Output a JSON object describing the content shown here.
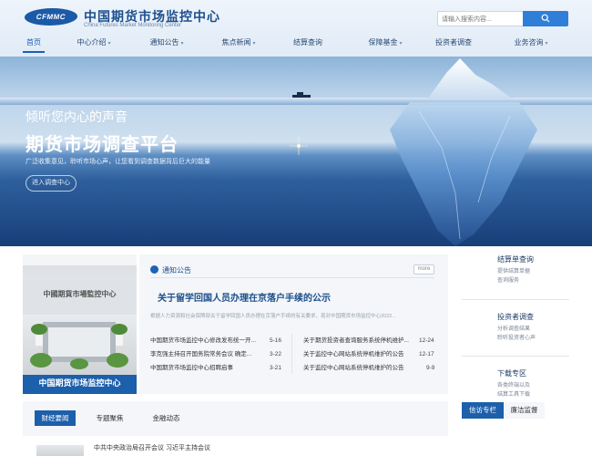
{
  "header": {
    "logo_abbr": "CFMMC",
    "logo_cn": "中国期货市场监控中心",
    "logo_en": "China Futures Market Monitoring Center",
    "search_placeholder": "请输入搜索内容..."
  },
  "nav": {
    "items": [
      {
        "label": "首页",
        "active": true,
        "dropdown": false
      },
      {
        "label": "中心介绍",
        "dropdown": true
      },
      {
        "label": "通知公告",
        "dropdown": true
      },
      {
        "label": "焦点新闻",
        "dropdown": true
      },
      {
        "label": "结算查询",
        "dropdown": false
      },
      {
        "label": "保障基金",
        "dropdown": true
      },
      {
        "label": "投资者调查",
        "dropdown": false
      },
      {
        "label": "业务咨询",
        "dropdown": true
      }
    ]
  },
  "banner": {
    "slogan1": "倾听您内心的声音",
    "slogan2": "期货市场调查平台",
    "slogan3": "广泛收集意见，聆听市场心声，让您看到调查数据背后巨大的能量",
    "button": "进入调查中心"
  },
  "photo": {
    "caption": "中国期货市场监控中心",
    "sign_text": "中國期貨市場監控中心"
  },
  "notice": {
    "title": "通知公告",
    "more": "more",
    "headline": "关于留学回国人员办理在京落户手续的公示",
    "headline_desc": "根据人力资源和社会保障部关于留学回国人员办理在京落户手续的有关要求，现对中国期货市场监控中心2022...",
    "left": [
      {
        "title": "中国期货市场监控中心修改发布统一开...",
        "date": "5-16"
      },
      {
        "title": "李克强主持召开国务院常务会议 确定...",
        "date": "3-22"
      },
      {
        "title": "中国期货市场监控中心招聘启事",
        "date": "3-21"
      }
    ],
    "right": [
      {
        "title": "关于期货投资者查询服务系统停机维护...",
        "date": "12-24"
      },
      {
        "title": "关于监控中心网站系统停机维护的公告",
        "date": "12-17"
      },
      {
        "title": "关于监控中心网站系统停机维护的公告",
        "date": "9-9"
      }
    ]
  },
  "tabs": {
    "items": [
      "财经要闻",
      "专题聚焦",
      "金融动态"
    ],
    "first_item": "中共中央政治局召开会议 习近平主持会议"
  },
  "sidebar": {
    "blocks": [
      {
        "title": "结算单查询",
        "sub1": "提供结算单据",
        "sub2": "查询服务"
      },
      {
        "title": "投资者调查",
        "sub1": "分析调查结果",
        "sub2": "聆听投资者心声"
      },
      {
        "title": "下载专区",
        "sub1": "各类终端以及",
        "sub2": "结算工具下载"
      }
    ],
    "tabs": [
      "信访专栏",
      "廉洁监督"
    ]
  },
  "colors": {
    "brand": "#1c5fab",
    "nav_text": "#2a4a74",
    "search_button": "#2f7fd9"
  }
}
